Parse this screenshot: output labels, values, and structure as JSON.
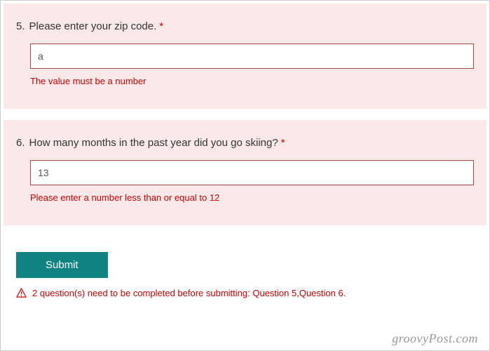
{
  "questions": [
    {
      "number": "5.",
      "label": "Please enter your zip code.",
      "required_star": "*",
      "value": "a",
      "error": "The value must be a number"
    },
    {
      "number": "6.",
      "label": "How many months in the past year did you go skiing?",
      "required_star": "*",
      "value": "13",
      "error": "Please enter a number less than or equal to 12"
    }
  ],
  "submit_label": "Submit",
  "summary_error": "2 question(s) need to be completed before submitting: Question 5,Question 6.",
  "watermark": "groovyPost.com"
}
